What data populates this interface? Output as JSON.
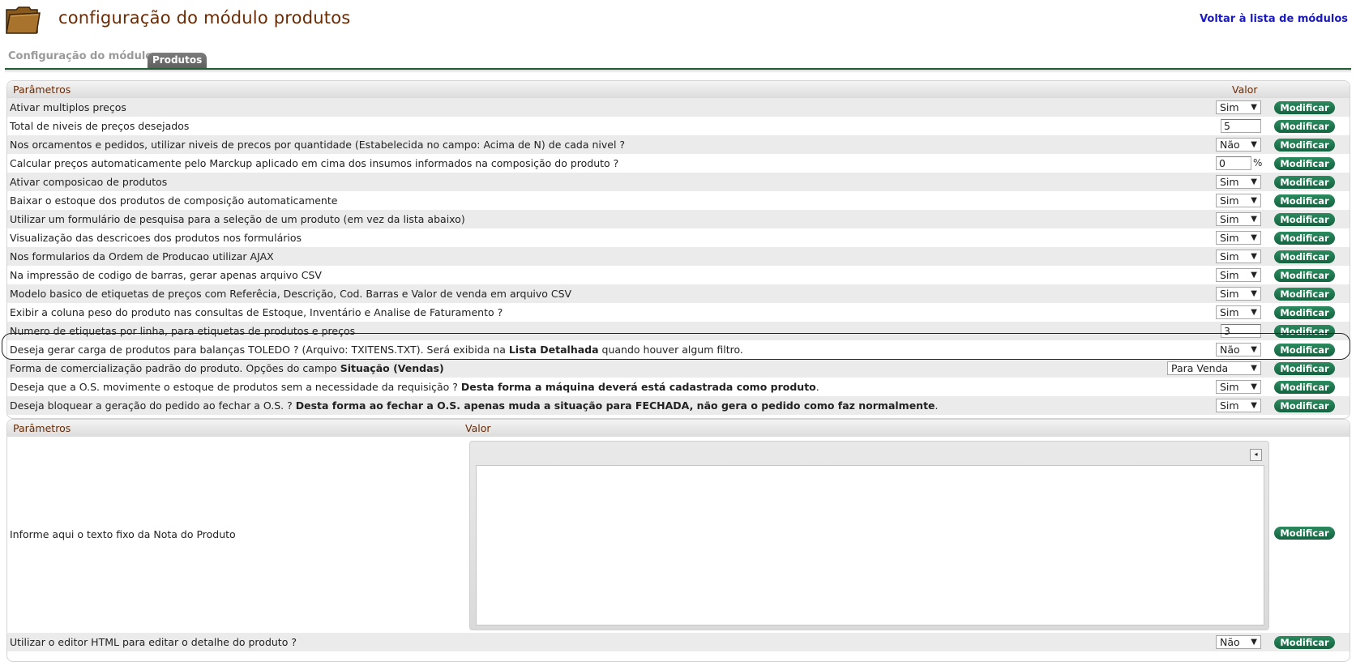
{
  "header": {
    "title": "configuração do módulo produtos",
    "back_link": "Voltar à lista de módulos"
  },
  "tabs": {
    "inactive": "Configuração do módulo",
    "active": "Produtos"
  },
  "panel1": {
    "col_param": "Parâmetros",
    "col_valor": "Valor",
    "button_label": "Modificar",
    "rows": [
      {
        "label": "Ativar multiplos preços",
        "control": "select",
        "value": "Sim"
      },
      {
        "label": "Total de niveis de preços desejados",
        "control": "text",
        "value": "5"
      },
      {
        "label": "Nos orcamentos e pedidos, utilizar niveis de precos por quantidade (Estabelecida no campo: Acima de N) de cada nivel ?",
        "control": "select",
        "value": "Não"
      },
      {
        "label": "Calcular preços automaticamente pelo Marckup aplicado em cima dos insumos informados na composição do produto ?",
        "control": "text-pct",
        "value": "0",
        "suffix": "%"
      },
      {
        "label": "Ativar composicao de produtos",
        "control": "select",
        "value": "Sim"
      },
      {
        "label": "Baixar o estoque dos produtos de composição automaticamente",
        "control": "select",
        "value": "Sim"
      },
      {
        "label": "Utilizar um formulário de pesquisa para a seleção de um produto (em vez da lista abaixo)",
        "control": "select",
        "value": "Sim"
      },
      {
        "label": "Visualização das descricoes dos produtos nos formulários",
        "control": "select",
        "value": "Sim"
      },
      {
        "label": "Nos formularios da Ordem de Producao utilizar AJAX",
        "control": "select",
        "value": "Sim"
      },
      {
        "label": "Na impressão de codigo de barras, gerar apenas arquivo CSV",
        "control": "select",
        "value": "Sim"
      },
      {
        "label": "Modelo basico de etiquetas de preços com Referêcia, Descrição, Cod. Barras e Valor de venda em arquivo CSV",
        "control": "select",
        "value": "Sim"
      },
      {
        "label": "Exibir a coluna peso do produto nas consultas de Estoque, Inventário e Analise de Faturamento ?",
        "control": "select",
        "value": "Sim"
      },
      {
        "label": "Numero de etiquetas por linha, para etiquetas de produtos e preços",
        "control": "text",
        "value": "3"
      },
      {
        "label_parts": [
          "Deseja gerar carga de produtos para balanças TOLEDO ? (Arquivo: TXITENS.TXT). Será exibida na ",
          "Lista Detalhada",
          " quando houver algum filtro."
        ],
        "control": "select",
        "value": "Não"
      },
      {
        "label_parts": [
          "Forma de comercialização padrão do produto. Opções do campo ",
          "Situação (Vendas)",
          ""
        ],
        "control": "select-wide",
        "value": "Para Venda"
      },
      {
        "label_parts": [
          "Deseja que a O.S. movimente o estoque de produtos sem a necessidade da requisição ? ",
          "Desta forma a máquina deverá está cadastrada como produto",
          "."
        ],
        "control": "select",
        "value": "Sim"
      },
      {
        "label_parts": [
          "Deseja bloquear a geração do pedido ao fechar a O.S. ? ",
          "Desta forma ao fechar a O.S. apenas muda a situação para FECHADA, não gera o pedido como faz normalmente",
          "."
        ],
        "control": "select",
        "value": "Sim"
      }
    ]
  },
  "panel2": {
    "col_param": "Parâmetros",
    "col_valor": "Valor",
    "button_label": "Modificar",
    "editor_row_label": "Informe aqui o texto fixo da Nota do Produto",
    "editor_toggle": "◂",
    "html_row_label": "Utilizar o editor HTML para editar o detalhe do produto ?",
    "html_row_value": "Não"
  },
  "icons": {
    "folder": "folder-icon",
    "dropdown": "▼"
  },
  "colors": {
    "title": "#6b2b05",
    "button": "#1c7048",
    "link": "#1a1ac0"
  }
}
